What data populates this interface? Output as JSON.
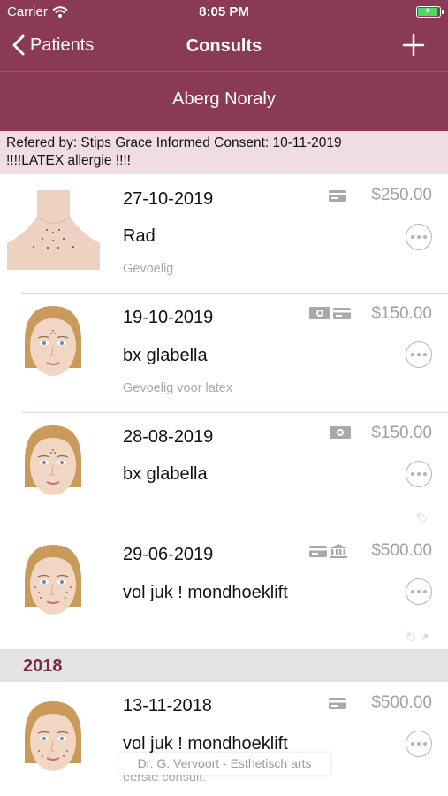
{
  "status_bar": {
    "carrier": "Carrier",
    "time": "8:05 PM"
  },
  "nav": {
    "back_label": "Patients",
    "title": "Consults"
  },
  "patient": {
    "name": "Aberg Noraly",
    "info_line1": "Refered by: Stips Grace  Informed Consent: 10-11-2019",
    "info_line2": "!!!!LATEX allergie !!!!"
  },
  "consults": [
    {
      "date": "27-10-2019",
      "title": "Rad",
      "note": "Gevoelig",
      "price": "$250.00",
      "payment_icons": [
        "card-icon"
      ],
      "image": "neck-photo"
    },
    {
      "date": "19-10-2019",
      "title": "bx glabella",
      "note": "Gevoelig voor latex",
      "price": "$150.00",
      "payment_icons": [
        "cash-icon",
        "card-icon"
      ],
      "image": "face-illustration"
    },
    {
      "date": "28-08-2019",
      "title": "bx glabella",
      "note": "",
      "price": "$150.00",
      "payment_icons": [
        "cash-icon"
      ],
      "image": "face-illustration"
    },
    {
      "date": "29-06-2019",
      "title": "vol juk ! mondhoeklift",
      "note": "",
      "price": "$500.00",
      "payment_icons": [
        "card-icon",
        "bank-icon"
      ],
      "image": "face-illustration"
    }
  ],
  "section_2018": {
    "label": "2018"
  },
  "consults_2018": [
    {
      "date": "13-11-2018",
      "title": "vol juk ! mondhoeklift",
      "note": "eerste consult.",
      "price": "$500.00",
      "payment_icons": [
        "card-icon"
      ],
      "image": "face-illustration"
    }
  ],
  "footer_toast": "Dr. G. Vervoort - Esthetisch arts",
  "colors": {
    "brand": "#8a3a55",
    "info_bg": "#f0dde3",
    "section_text": "#7a2a44"
  }
}
